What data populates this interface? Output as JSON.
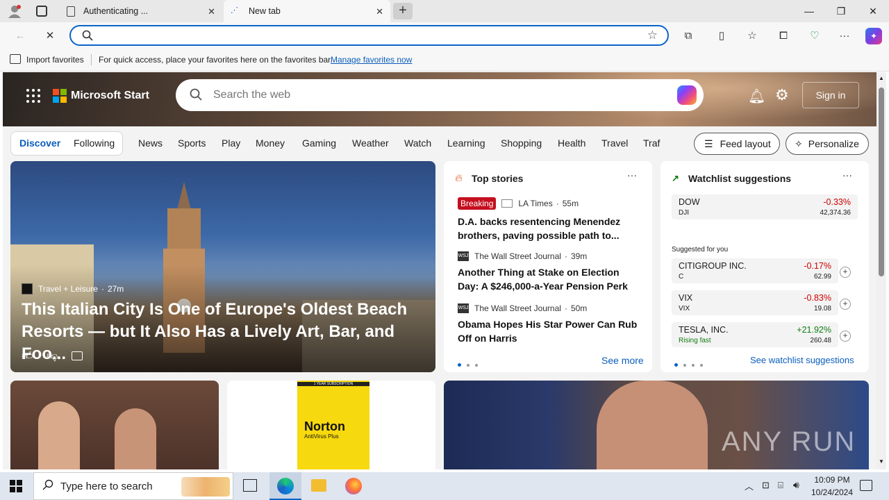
{
  "browser": {
    "tabs": [
      {
        "label": "Authenticating ..."
      },
      {
        "label": "New tab"
      }
    ],
    "address_placeholder": "",
    "favorites_bar": {
      "import_label": "Import favorites",
      "message": "For quick access, place your favorites here on the favorites bar.",
      "manage_link": "Manage favorites now"
    }
  },
  "header": {
    "brand": "Microsoft Start",
    "search_placeholder": "Search the web",
    "sign_in": "Sign in"
  },
  "nav": {
    "discover": "Discover",
    "following": "Following",
    "categories": [
      "News",
      "Sports",
      "Play",
      "Money",
      "Gaming",
      "Weather",
      "Watch",
      "Learning",
      "Shopping",
      "Health",
      "Travel",
      "Traf"
    ],
    "feed_layout": "Feed layout",
    "personalize": "Personalize"
  },
  "hero_story": {
    "source": "Travel + Leisure",
    "time": "27m",
    "title": "This Italian City Is One of Europe's Oldest Beach Resorts — but It Also Has a Lively Art, Bar, and Foo..."
  },
  "top_stories": {
    "heading": "Top stories",
    "items": [
      {
        "badge": "Breaking",
        "source": "LA Times",
        "time": "55m",
        "title": "D.A. backs resentencing Menendez brothers, paving possible path to..."
      },
      {
        "badge": "",
        "source": "The Wall Street Journal",
        "time": "39m",
        "title": "Another Thing at Stake on Election Day: A $246,000-a-Year Pension Perk"
      },
      {
        "badge": "",
        "source": "The Wall Street Journal",
        "time": "50m",
        "title": "Obama Hopes His Star Power Can Rub Off on Harris"
      }
    ],
    "see_more": "See more"
  },
  "watchlist": {
    "heading": "Watchlist suggestions",
    "main": {
      "name": "DOW",
      "symbol": "DJI",
      "change": "-0.33%",
      "price": "42,374.36"
    },
    "suggested_label": "Suggested for you",
    "items": [
      {
        "name": "CITIGROUP INC.",
        "symbol": "C",
        "change": "-0.17%",
        "price": "62.99"
      },
      {
        "name": "VIX",
        "symbol": "VIX",
        "change": "-0.83%",
        "price": "19.08"
      },
      {
        "name": "TESLA, INC.",
        "symbol": "Rising fast",
        "change": "+21.92%",
        "price": "260.48"
      }
    ],
    "see_link": "See watchlist suggestions",
    "colors": {
      "negative": "#c50f1f",
      "positive": "#107c10"
    }
  },
  "ad": {
    "product": "Norton",
    "sub": "AntiVirus Plus",
    "top": "1 YEAR SUBSCRIPTION"
  },
  "watermark": "ANY RUN",
  "taskbar": {
    "search_placeholder": "Type here to search",
    "time": "10:09 PM",
    "date": "10/24/2024"
  }
}
